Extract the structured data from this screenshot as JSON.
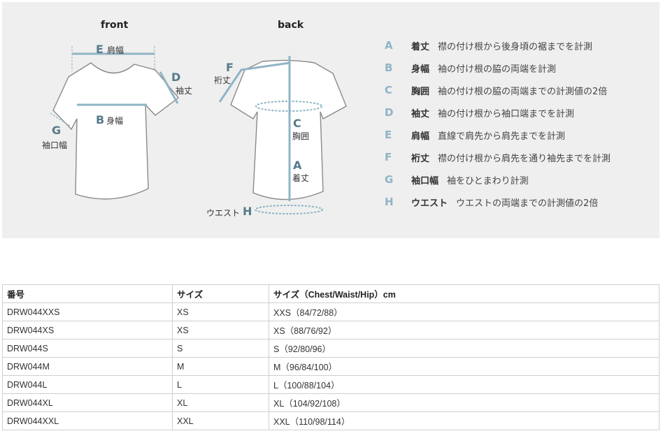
{
  "guide": {
    "front_title": "front",
    "back_title": "back",
    "front_labels": {
      "E_letter": "E",
      "E_text": "肩幅",
      "D_letter": "D",
      "D_text": "袖丈",
      "B_letter": "B",
      "B_text": "身幅",
      "G_letter": "G",
      "G_text": "袖口幅"
    },
    "back_labels": {
      "F_letter": "F",
      "F_text": "裄丈",
      "C_letter": "C",
      "C_text": "胸囲",
      "A_letter": "A",
      "A_text": "着丈",
      "H_letter": "H",
      "H_text": "ウエスト"
    },
    "colors": {
      "background": "#efefef",
      "measure_line": "#8fb4c6",
      "letter_accent": "#8fb4c6"
    },
    "legend": [
      {
        "letter": "A",
        "term": "着丈",
        "desc": "襟の付け根から後身頃の裾までを計測"
      },
      {
        "letter": "B",
        "term": "身幅",
        "desc": "袖の付け根の脇の両端を計測"
      },
      {
        "letter": "C",
        "term": "胸囲",
        "desc": "袖の付け根の脇の両端までの計測値の2倍"
      },
      {
        "letter": "D",
        "term": "袖丈",
        "desc": "袖の付け根から袖口端までを計測"
      },
      {
        "letter": "E",
        "term": "肩幅",
        "desc": "直線で肩先から肩先までを計測"
      },
      {
        "letter": "F",
        "term": "裄丈",
        "desc": "襟の付け根から肩先を通り袖先までを計測"
      },
      {
        "letter": "G",
        "term": "袖口幅",
        "desc": "袖をひとまわり計測"
      },
      {
        "letter": "H",
        "term": "ウエスト",
        "desc": "ウエストの両端までの計測値の2倍"
      }
    ]
  },
  "size_table": {
    "headers": [
      "番号",
      "サイズ",
      "サイズ（Chest/Waist/Hip）cm"
    ],
    "rows": [
      [
        "DRW044XXS",
        "XS",
        "XXS（84/72/88）"
      ],
      [
        "DRW044XS",
        "XS",
        "XS（88/76/92）"
      ],
      [
        "DRW044S",
        "S",
        "S（92/80/96）"
      ],
      [
        "DRW044M",
        "M",
        "M（96/84/100）"
      ],
      [
        "DRW044L",
        "L",
        "L（100/88/104）"
      ],
      [
        "DRW044XL",
        "XL",
        "XL（104/92/108）"
      ],
      [
        "DRW044XXL",
        "XXL",
        "XXL（110/98/114）"
      ]
    ]
  }
}
